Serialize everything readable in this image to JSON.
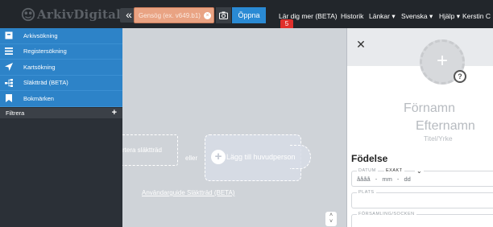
{
  "header": {
    "logo_text": "ArkivDigital",
    "collapse_label": "«",
    "search": {
      "placeholder": "Gensög (ex. v649.b1)",
      "value": ""
    },
    "clear_label": "⊗",
    "open_label": "Öppna",
    "nav": {
      "learn_more": "Lär dig mer (BETA)",
      "history": "Historik",
      "links": "Länkar ▾",
      "language": "Svenska ▾",
      "help": "Hjälp ▾",
      "user": "Kerstin C"
    },
    "notification_count": "5"
  },
  "sidebar": {
    "items": [
      {
        "label": "Arkivsökning",
        "icon": "archive-icon"
      },
      {
        "label": "Registersökning",
        "icon": "list-icon"
      },
      {
        "label": "Kartsökning",
        "icon": "location-arrow-icon"
      },
      {
        "label": "Släktträd (BETA)",
        "icon": "family-tree-icon"
      },
      {
        "label": "Bokmärken",
        "icon": "bookmark-icon"
      }
    ],
    "filter_label": "Filtrera",
    "filter_add": "+"
  },
  "canvas": {
    "import_label": "rtera släktträd",
    "or_label": "eller",
    "add_main_person": "Lägg till huvudperson",
    "guide_link": "Användarguide Släktträd (BETA)"
  },
  "panel": {
    "close_label": "✕",
    "help_label": "?",
    "first_name": "Förnamn",
    "last_name": "Efternamn",
    "title": "Titel/Yrke",
    "section_birth": "Födelse",
    "date_legend": "DATUM",
    "date_mode": "EXAKT",
    "date_placeholder": "åååå - mm - dd",
    "place_legend": "PLATS",
    "parish_legend": "FÖRSAMLING/SOCKEN"
  },
  "colors": {
    "topbar": "#22262b",
    "menu": "#2d83c8",
    "search": "#e9a383",
    "open_button": "#2a8ad4",
    "badge": "#e0302c",
    "sidebar": "#2b3037",
    "canvas": "#cfd3d8"
  }
}
